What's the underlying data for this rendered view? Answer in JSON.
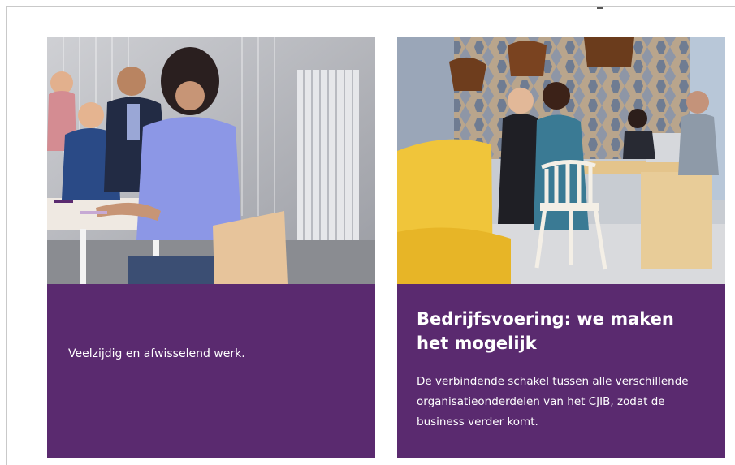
{
  "cards": [
    {
      "image": "office-teamwork-photo",
      "description": "Veelzijdig en afwisselend werk."
    },
    {
      "image": "office-meeting-photo",
      "title": "Bedrijfsvoering: we maken het mogelijk",
      "description": "De verbindende schakel tussen alle verschillende organisatieonderdelen van het CJIB, zodat de business verder komt."
    }
  ],
  "colors": {
    "card_background": "#5a2a6f",
    "card_text": "#ffffff"
  }
}
